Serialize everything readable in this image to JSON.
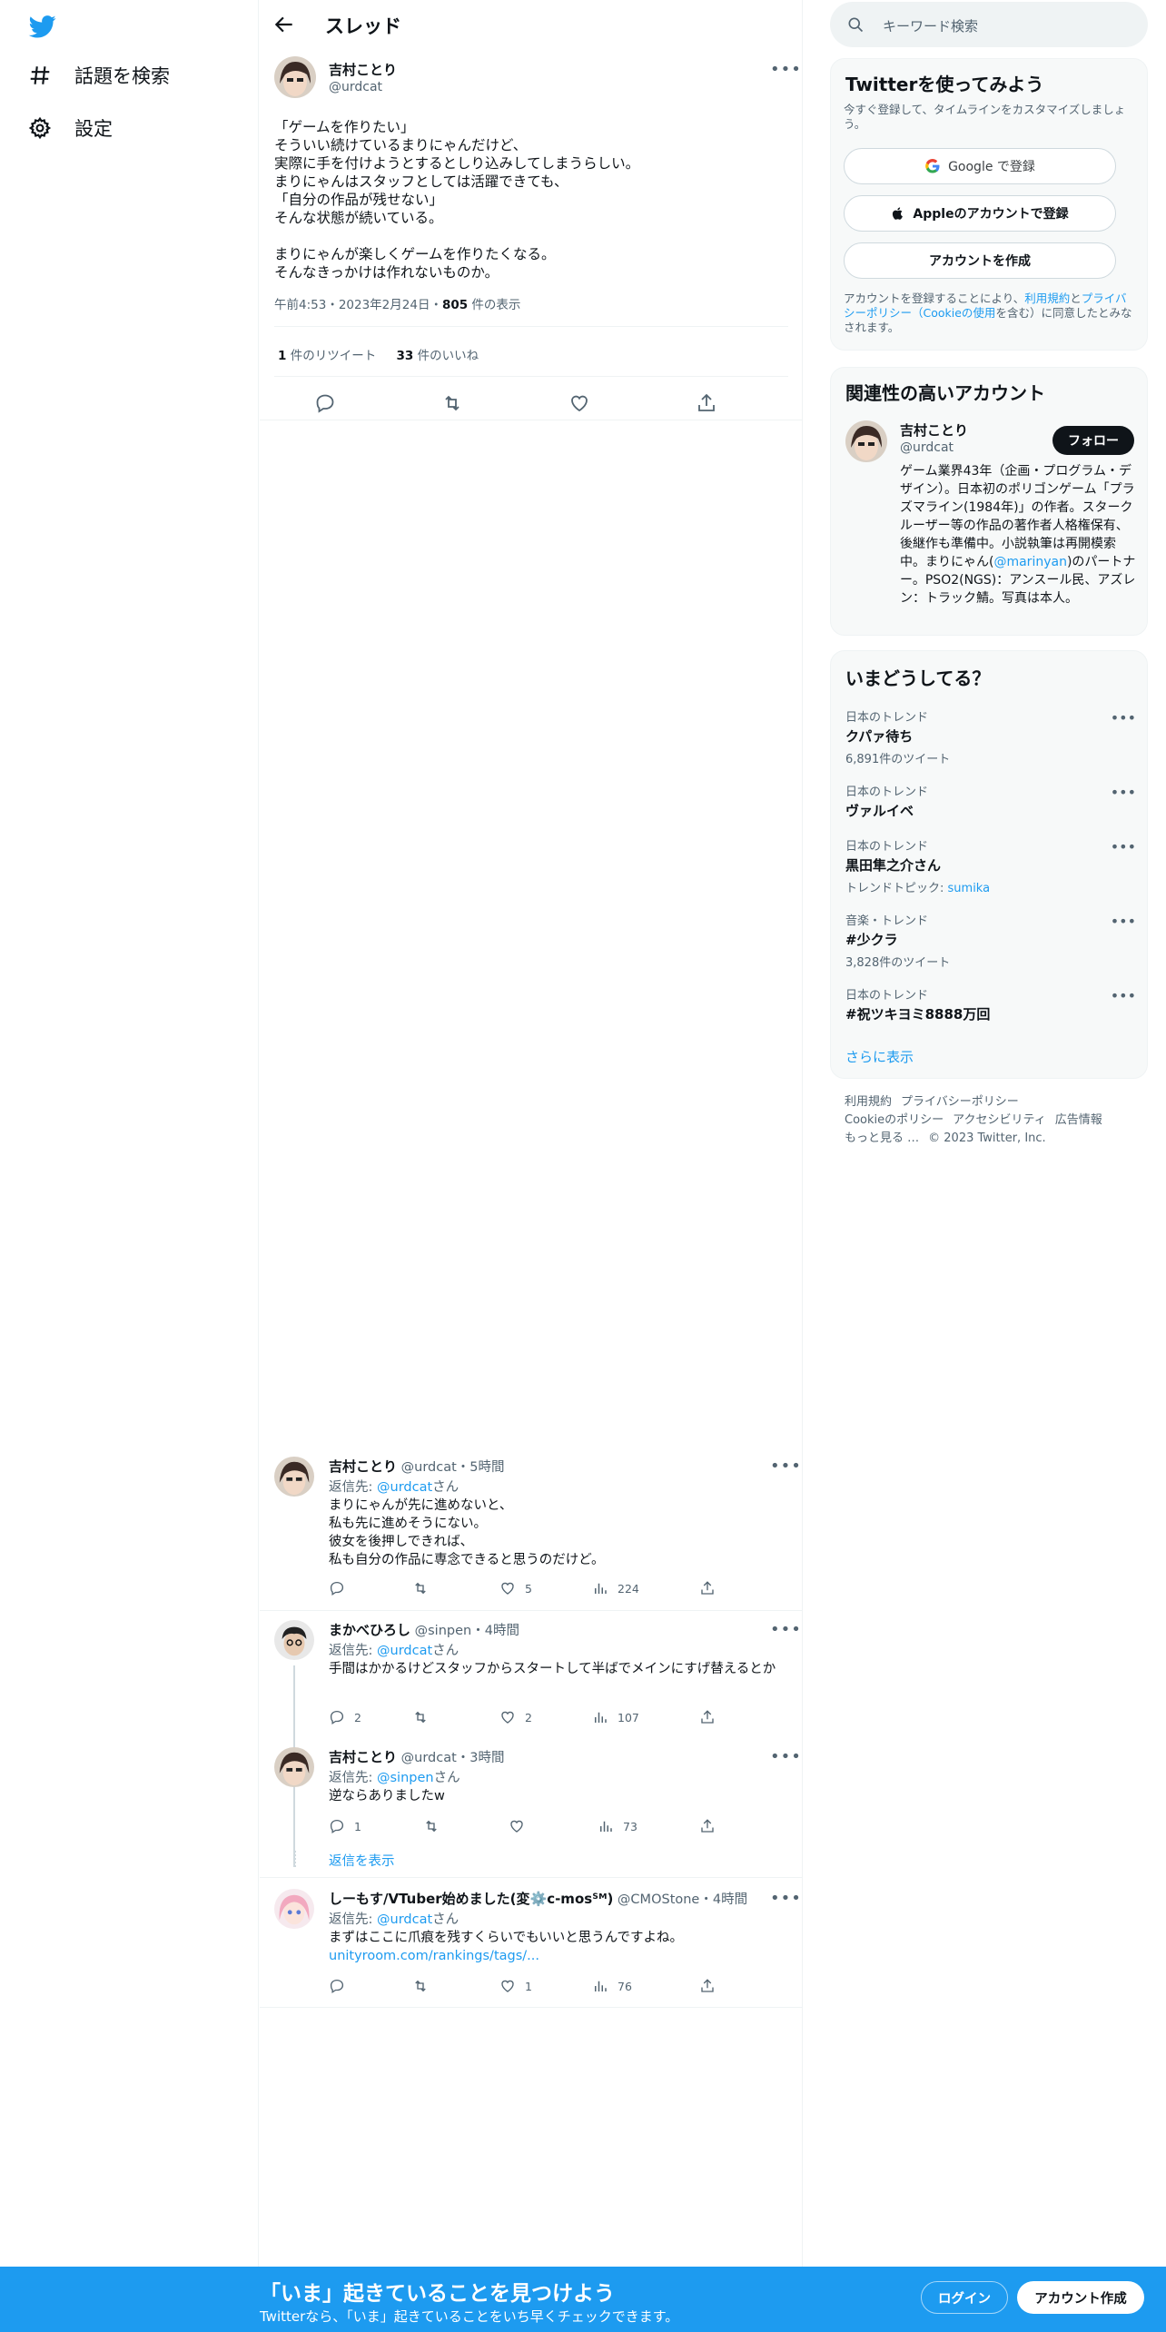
{
  "colors": {
    "accent": "#1d9bf0",
    "text": "#0f1419",
    "muted": "#536471",
    "banner_bg": "#1d9bf0",
    "follow_bg": "#0f1419"
  },
  "nav": {
    "logo_icon": "twitter-bird-icon",
    "items": [
      {
        "label": "話題を検索",
        "icon": "hashtag-icon"
      },
      {
        "label": "設定",
        "icon": "gear-icon"
      }
    ]
  },
  "header": {
    "title": "スレッド"
  },
  "main_tweet": {
    "name": "吉村ことり",
    "handle": "@urdcat",
    "text": "「ゲームを作りたい」\nそういい続けているまりにゃんだけど、\n実際に手を付けようとするとしり込みしてしまうらしい。\nまりにゃんはスタッフとしては活躍できても、\n「自分の作品が残せない」\nそんな状態が続いている。\n\nまりにゃんが楽しくゲームを作りたくなる。\nそんなきっかけは作れないものか。",
    "meta_prefix": "午前4:53・2023年2月24日・",
    "views": "805",
    "views_label": " 件の表示",
    "retweets": "1",
    "retweets_label": " 件のリツイート",
    "likes": "33",
    "likes_label": " 件のいいね"
  },
  "replies": [
    {
      "name": "吉村ことり",
      "handle_time": " @urdcat・5時間",
      "to_prefix": "返信先: ",
      "to_handle": "@urdcat",
      "to_suffix": "さん",
      "text": "まりにゃんが先に進めないと、\n私も先に進めそうにない。\n彼女を後押しできれば、\n私も自分の作品に専念できると思うのだけど。",
      "replies": "",
      "retweets": "",
      "likes": "5",
      "views": "224"
    },
    {
      "name": "まかべひろし",
      "handle_time": " @sinpen・4時間",
      "to_prefix": "返信先: ",
      "to_handle": "@urdcat",
      "to_suffix": "さん",
      "text": "手間はかかるけどスタッフからスタートして半ばでメインにすげ替えるとか",
      "replies": "2",
      "retweets": "",
      "likes": "2",
      "views": "107"
    },
    {
      "name": "吉村ことり",
      "handle_time": " @urdcat・3時間",
      "to_prefix": "返信先: ",
      "to_handle": "@sinpen",
      "to_suffix": "さん",
      "text": "逆ならありましたw",
      "replies": "1",
      "retweets": "",
      "likes": "",
      "views": "73",
      "show_replies": "返信を表示"
    },
    {
      "name": "しーもす/VTuber始めました(変⚙️c-mosᔆᴹ)",
      "handle_time": " @CMOStone・4時間",
      "to_prefix": "返信先: ",
      "to_handle": "@urdcat",
      "to_suffix": "さん",
      "text": "まずはここに爪痕を残すくらいでもいいと思うんですよね。",
      "link": "unityroom.com/rankings/tags/...",
      "replies": "",
      "retweets": "",
      "likes": "1",
      "views": "76"
    }
  ],
  "search": {
    "placeholder": "キーワード検索"
  },
  "signup_card": {
    "title": "Twitterを使ってみよう",
    "subtitle": "今すぐ登録して、タイムラインをカスタマイズしましょう。",
    "google": "Google で登録",
    "apple": "Appleのアカウントで登録",
    "create": "アカウントを作成",
    "legal_1": "アカウントを登録することにより、",
    "legal_terms": "利用規約",
    "legal_2": "と",
    "legal_privacy": "プライバシーポリシー（Cookieの使用",
    "legal_3": "を含む）に同意したとみなされます。"
  },
  "related": {
    "title": "関連性の高いアカウント",
    "name": "吉村ことり",
    "handle": "@urdcat",
    "follow": "フォロー",
    "bio_1": "ゲーム業界43年（企画・プログラム・デザイン）。日本初のポリゴンゲーム「プラズマライン(1984年)」の作者。スタークルーザー等の作品の著作者人格権保有、後継作も準備中。小説執筆は再開模索中。まりにゃん(",
    "bio_link": "@marinyan",
    "bio_2": ")のパートナー。PSO2(NGS)：アンスール民、アズレン：トラック鯖。写真は本人。"
  },
  "trends": {
    "title": "いまどうしてる？",
    "items": [
      {
        "category": "日本のトレンド",
        "name": "クパァ待ち",
        "sub": "6,891件のツイート"
      },
      {
        "category": "日本のトレンド",
        "name": "ヴァルイベ",
        "sub": ""
      },
      {
        "category": "日本のトレンド",
        "name": "黒田隼之介さん",
        "sub": "トレンドトピック: ",
        "sub_link": "sumika"
      },
      {
        "category": "音楽・トレンド",
        "name": "#少クラ",
        "sub": "3,828件のツイート"
      },
      {
        "category": "日本のトレンド",
        "name": "#祝ツキヨミ8888万回",
        "sub": ""
      }
    ],
    "more": "さらに表示"
  },
  "footer": {
    "line1": [
      "利用規約",
      "プライバシーポリシー"
    ],
    "line2": [
      "Cookieのポリシー",
      "アクセシビリティ",
      "広告情報"
    ],
    "line3": [
      "もっと見る …",
      "© 2023 Twitter, Inc."
    ]
  },
  "banner": {
    "title": "「いま」起きていることを見つけよう",
    "subtitle": "Twitterなら、「いま」起きていることをいち早くチェックできます。",
    "login": "ログイン",
    "signup": "アカウント作成"
  }
}
